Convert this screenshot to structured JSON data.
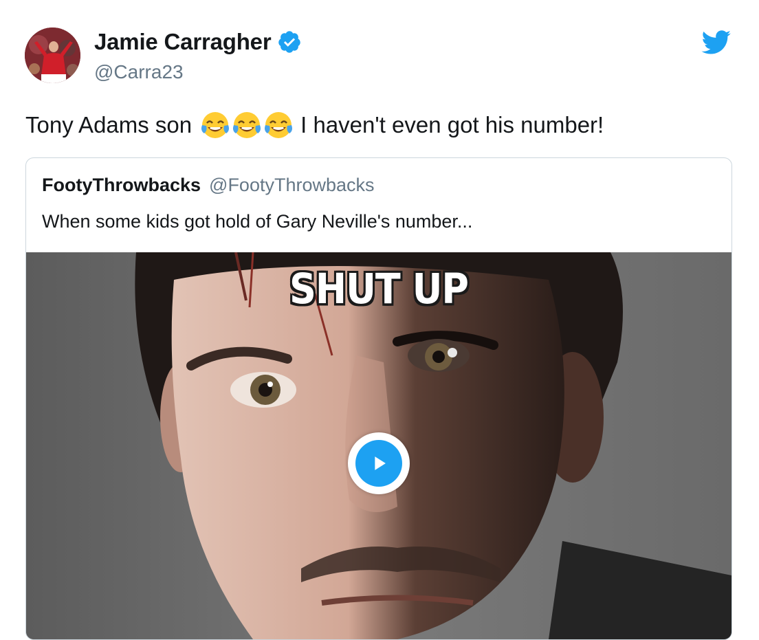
{
  "author": {
    "display_name": "Jamie Carragher",
    "handle": "@Carra23",
    "verified": true,
    "avatar_icon": "player-avatar"
  },
  "brand": {
    "icon": "twitter-bird-icon",
    "color": "#1da1f2"
  },
  "tweet": {
    "text_before": "Tony Adams son",
    "emojis": [
      "face-with-tears-of-joy-icon",
      "face-with-tears-of-joy-icon",
      "face-with-tears-of-joy-icon"
    ],
    "text_after": "I haven't even got his number!"
  },
  "quoted_tweet": {
    "display_name": "FootyThrowbacks",
    "handle": "@FootyThrowbacks",
    "text": "When some kids got hold of Gary Neville's number...",
    "media": {
      "type": "video",
      "caption": "SHUT UP",
      "play_icon": "play-icon"
    }
  },
  "colors": {
    "text": "#14171a",
    "secondary_text": "#657786",
    "accent": "#1da1f2",
    "border": "#ccd6dd"
  }
}
